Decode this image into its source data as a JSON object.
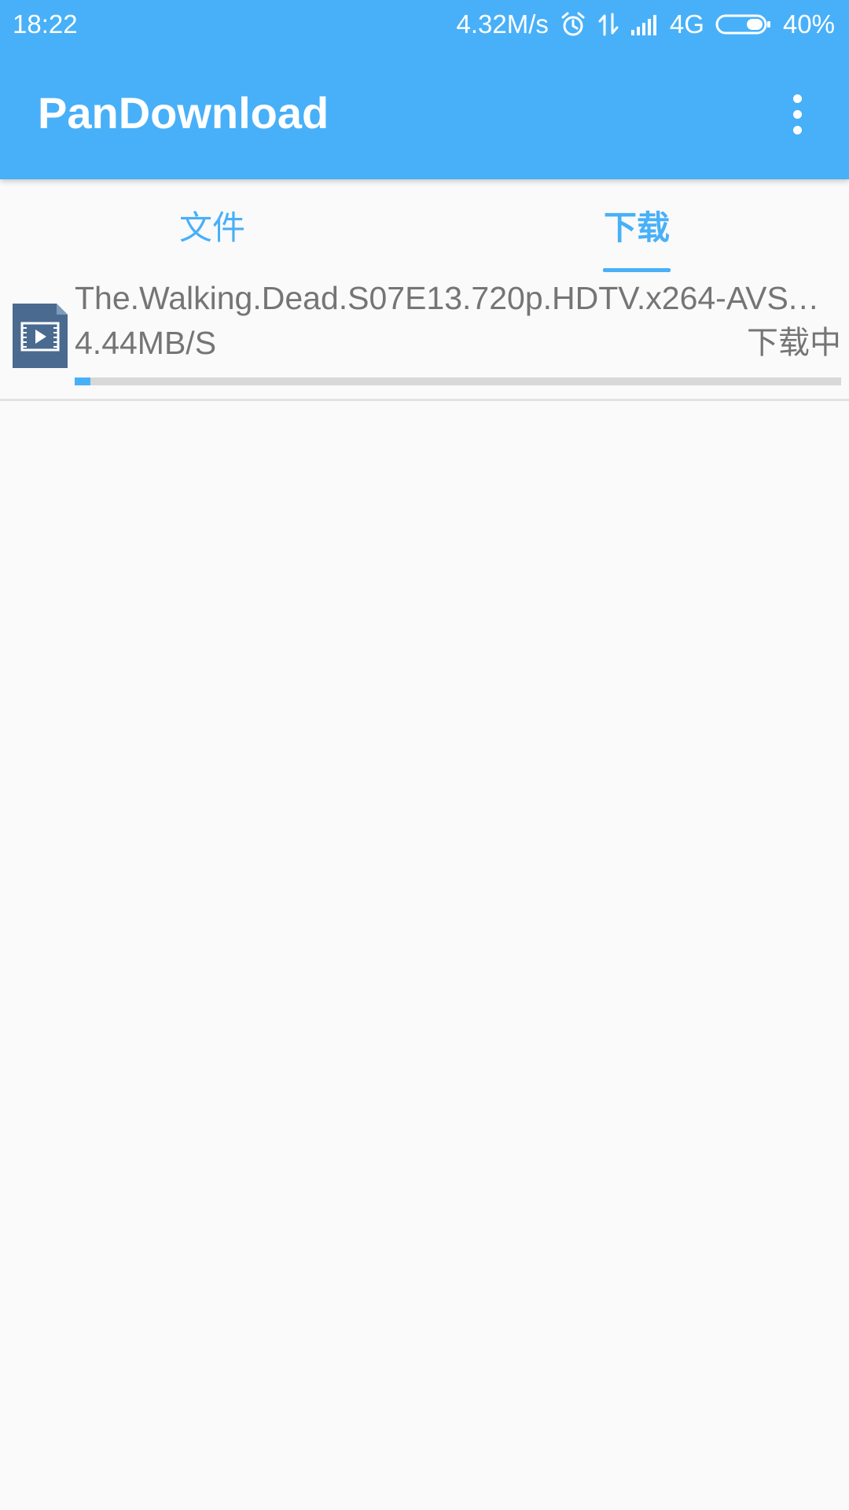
{
  "status_bar": {
    "time": "18:22",
    "net_speed": "4.32M/s",
    "network": "4G",
    "battery": "40%",
    "icons": [
      "alarm-icon",
      "data-transfer-icon",
      "signal-icon",
      "battery-icon"
    ]
  },
  "app_bar": {
    "title": "PanDownload",
    "menu_icon": "more-vert-icon"
  },
  "tabs": [
    {
      "label": "文件",
      "selected": false
    },
    {
      "label": "下载",
      "selected": true
    }
  ],
  "downloads": [
    {
      "icon": "video-file-icon",
      "file_name": "The.Walking.Dead.S07E13.720p.HDTV.x264-AVS.…",
      "speed": "4.44MB/S",
      "state": "下载中",
      "progress": 0.02
    }
  ],
  "colors": {
    "accent": "#48b0f8",
    "text_secondary": "#757575",
    "file_icon": "#4a6a90"
  }
}
